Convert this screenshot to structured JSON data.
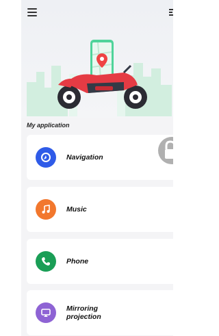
{
  "header": {
    "menu_icon": "hamburger-menu-icon",
    "right_icon": "toggle-icon"
  },
  "hero": {
    "illustration": "motorcycle-with-phone-map-illustration"
  },
  "section": {
    "title": "My application"
  },
  "apps": [
    {
      "label": "Navigation",
      "icon": "navigation-icon",
      "color": "#2f5be8"
    },
    {
      "label": "Music",
      "icon": "music-icon",
      "color": "#f2772d"
    },
    {
      "label": "Phone",
      "icon": "phone-icon",
      "color": "#1a9e56"
    },
    {
      "label": "Mirroring projection",
      "icon": "mirroring-projection-icon",
      "color": "#8e63d4"
    }
  ],
  "floating_button": {
    "icon": "lock-icon",
    "color": "#b0b0b0"
  }
}
